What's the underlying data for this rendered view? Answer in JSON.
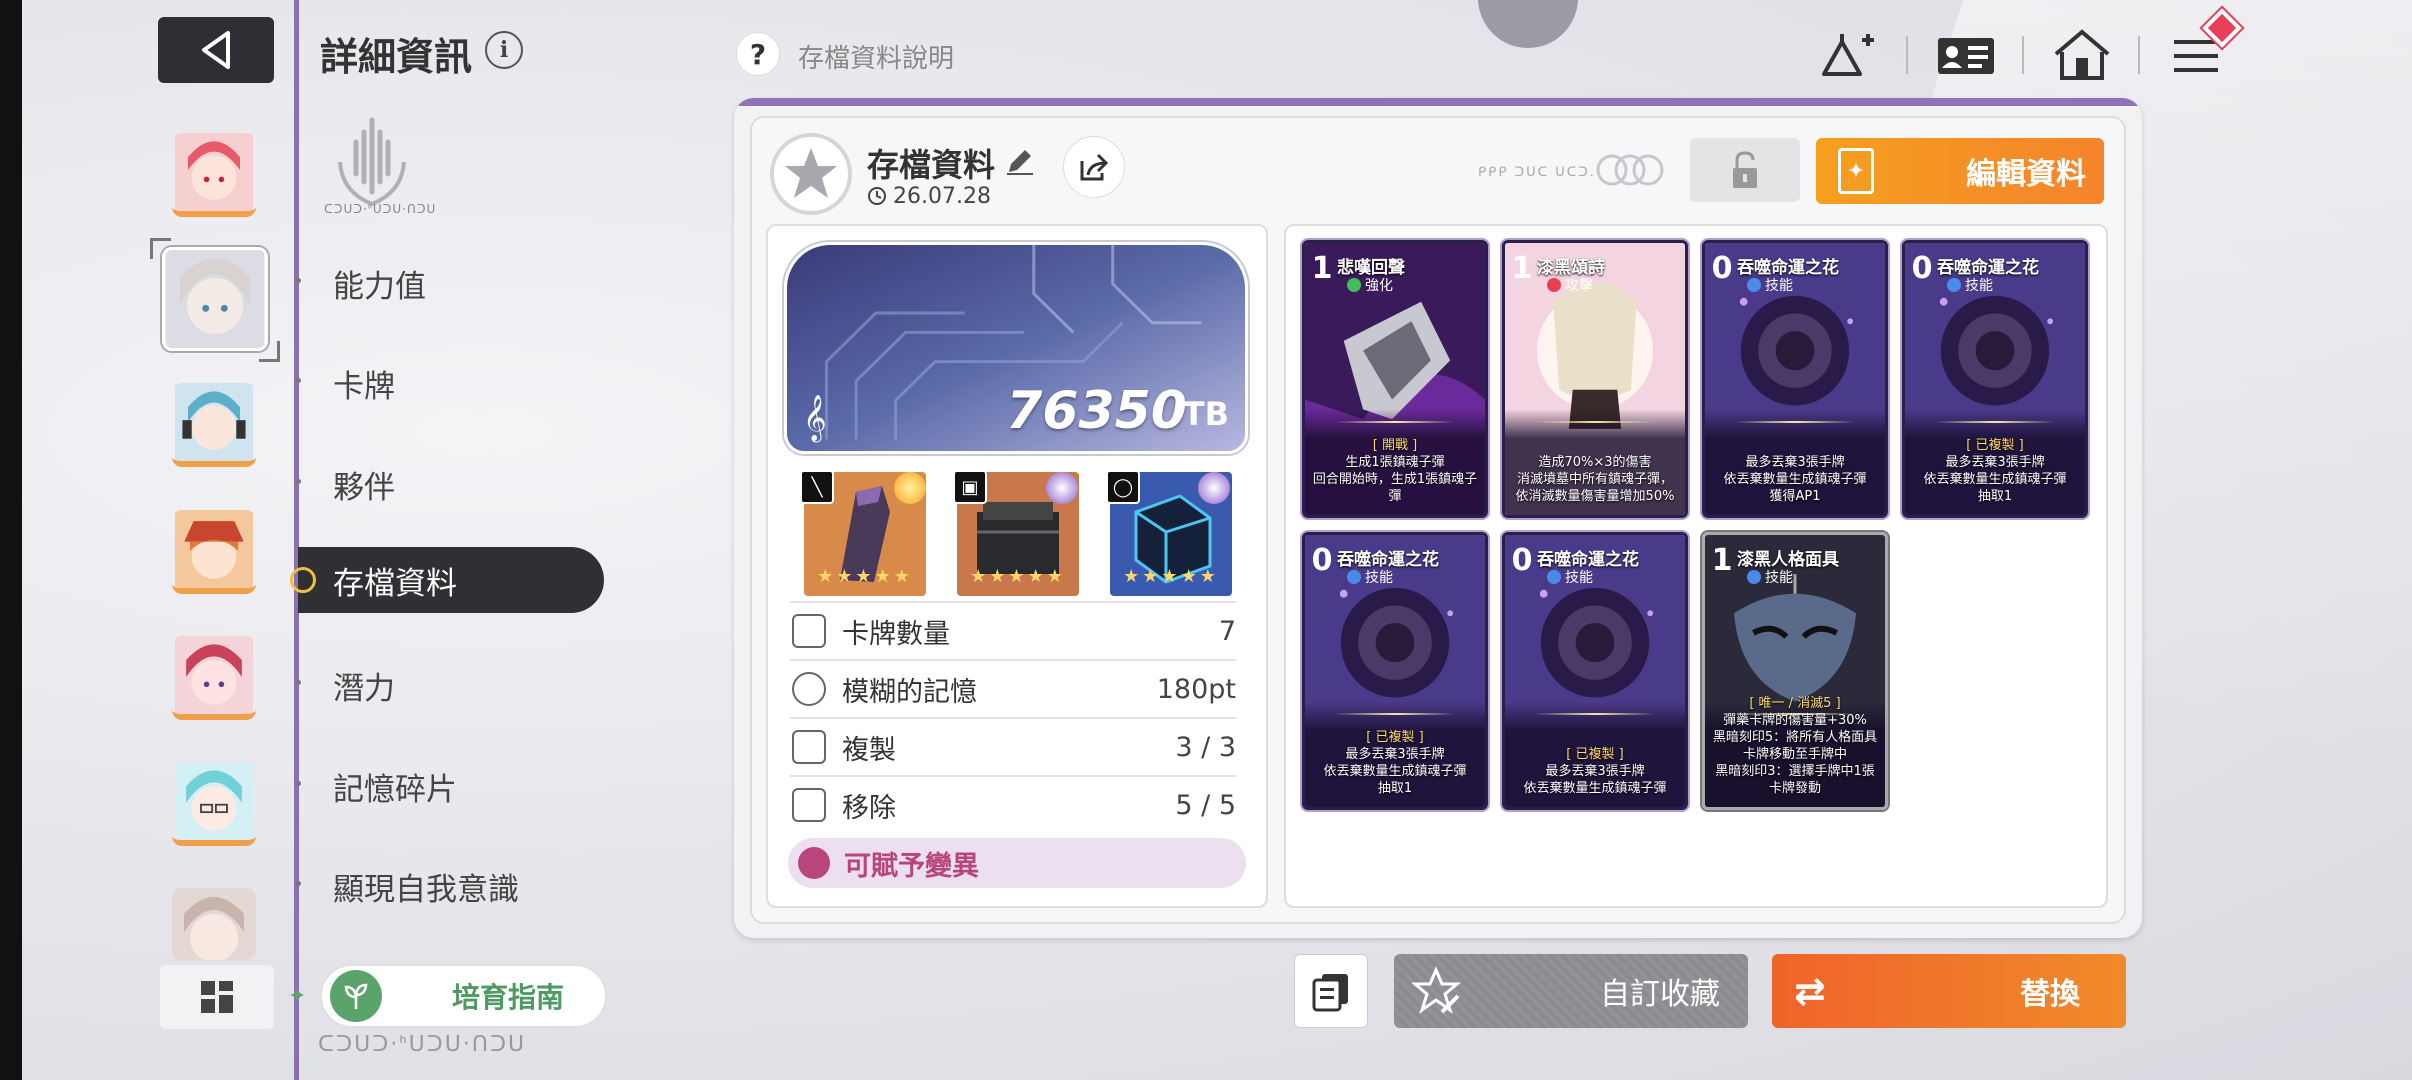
{
  "header": {
    "page_title": "詳細資訊",
    "info_label": "i",
    "help_label": "存檔資料說明",
    "help_symbol": "?"
  },
  "sidebar": {
    "nav_items": [
      "能力值",
      "卡牌",
      "夥伴",
      "存檔資料",
      "潛力",
      "記憶碎片",
      "顯現自我意識"
    ],
    "active_item": "存檔資料",
    "emblem_caption": "ᑕᑐᑌᑐ·ᑋᑌᑐᑌ·ᑎᑐᑌ",
    "guide_button": "培育指南",
    "footer_caption": "ᑕᑐᑌᑐ·ᑋᑌᑐᑌ·ᑎᑐᑌ"
  },
  "save": {
    "title": "存檔資料",
    "date": "26.07.28",
    "tiny_caption": "ᑭᑭᑭ ᑐᑌᑕ ᑌᑕᑐ.",
    "edit_button": "編輯資料",
    "tb_value": "76350",
    "tb_unit": "TB",
    "stats": [
      {
        "label": "卡牌數量",
        "value": "7"
      },
      {
        "label": "模糊的記憶",
        "value": "180pt"
      },
      {
        "label": "複製",
        "value": "3 / 3"
      },
      {
        "label": "移除",
        "value": "5 / 5"
      }
    ],
    "mutation_label": "可賦予變異",
    "equipment_stars": "★★★★★"
  },
  "cards": [
    {
      "cost": "1",
      "title": "悲嘆回聲",
      "type": "強化",
      "type_color": "#3fbf5a",
      "tag": "[ 開戰 ]",
      "desc": "生成1張鎮魂子彈\n回合開始時，生成1張鎮魂子彈"
    },
    {
      "cost": "1",
      "title": "漆黑頌詩",
      "type": "攻擊",
      "type_color": "#e84050",
      "tag": "",
      "desc": "造成70%×3的傷害\n消滅墳墓中所有鎮魂子彈，依消滅數量傷害量增加50%"
    },
    {
      "cost": "0",
      "title": "吞噬命運之花",
      "type": "技能",
      "type_color": "#4a8ae8",
      "tag": "",
      "desc": "最多丟棄3張手牌\n依丟棄數量生成鎮魂子彈\n獲得AP1"
    },
    {
      "cost": "0",
      "title": "吞噬命運之花",
      "type": "技能",
      "type_color": "#4a8ae8",
      "tag": "[ 已複製 ]",
      "desc": "最多丟棄3張手牌\n依丟棄數量生成鎮魂子彈\n抽取1"
    },
    {
      "cost": "0",
      "title": "吞噬命運之花",
      "type": "技能",
      "type_color": "#4a8ae8",
      "tag": "[ 已複製 ]",
      "desc": "最多丟棄3張手牌\n依丟棄數量生成鎮魂子彈\n抽取1"
    },
    {
      "cost": "0",
      "title": "吞噬命運之花",
      "type": "技能",
      "type_color": "#4a8ae8",
      "tag": "[ 已複製 ]",
      "desc": "最多丟棄3張手牌\n依丟棄數量生成鎮魂子彈"
    },
    {
      "cost": "1",
      "title": "漆黑人格面具",
      "type": "技能",
      "type_color": "#4a8ae8",
      "tag": "[ 唯一 / 消滅5 ]",
      "desc": "彈藥卡牌的傷害量+30%\n黑暗刻印5：將所有人格面具卡牌移動至手牌中\n黑暗刻印3：選擇手牌中1張卡牌發動"
    }
  ],
  "bottom": {
    "favorite_button": "自訂收藏",
    "swap_button": "替換",
    "swap_symbol": "⇄"
  },
  "colors": {
    "accent_purple": "#8c74b6",
    "edit_orange": "#f5a020",
    "swap_orange": "#f0632a",
    "guide_green": "#5aa36b"
  },
  "icons": [
    "back-arrow-icon",
    "info-icon",
    "help-icon",
    "add-friend-icon",
    "profile-card-icon",
    "home-icon",
    "menu-icon",
    "share-icon",
    "lock-icon",
    "edit-pencil-icon",
    "clock-icon",
    "grid-icon",
    "collection-icon",
    "swap-icon"
  ]
}
